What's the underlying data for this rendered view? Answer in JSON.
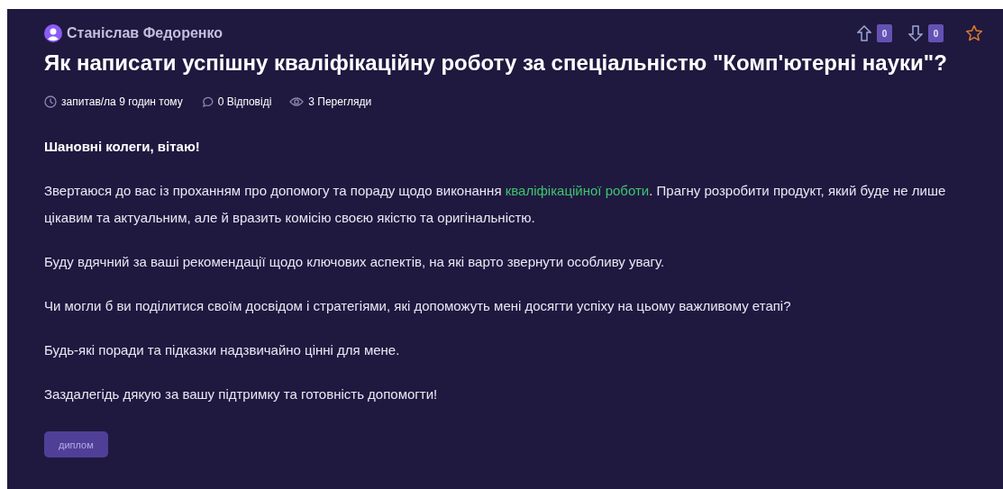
{
  "author": {
    "name": "Станіслав Федоренко"
  },
  "votes": {
    "up": "0",
    "down": "0"
  },
  "title": "Як написати успішну кваліфікаційну роботу за спеціальністю \"Комп'ютерні науки\"?",
  "meta": {
    "asked": "запитав/ла 9 годин тому",
    "answers": "0 Відповіді",
    "views": "3 Перегляди"
  },
  "body": [
    {
      "kind": "heading",
      "text": "Шановні колеги, вітаю!"
    },
    {
      "kind": "linked",
      "before": "Звертаюся до вас із проханням про допомогу та пораду щодо виконання ",
      "link": "кваліфікаційної роботи",
      "after": ". Прагну розробити продукт, який буде не лише цікавим та актуальним, але й вразить комісію своєю якістю та оригінальністю."
    },
    {
      "kind": "text",
      "text": "Буду вдячний за ваші рекомендації щодо ключових аспектів, на які варто звернути особливу увагу."
    },
    {
      "kind": "text",
      "text": "Чи могли б ви поділитися своїм досвідом і стратегіями, які допоможуть мені досягти успіху на цьому важливому етапі?"
    },
    {
      "kind": "text",
      "text": "Будь-які поради та підказки надзвичайно цінні для мене."
    },
    {
      "kind": "text",
      "text": "Заздалегідь дякую за вашу підтримку та готовність допомогти!"
    }
  ],
  "tags": [
    "диплом"
  ]
}
